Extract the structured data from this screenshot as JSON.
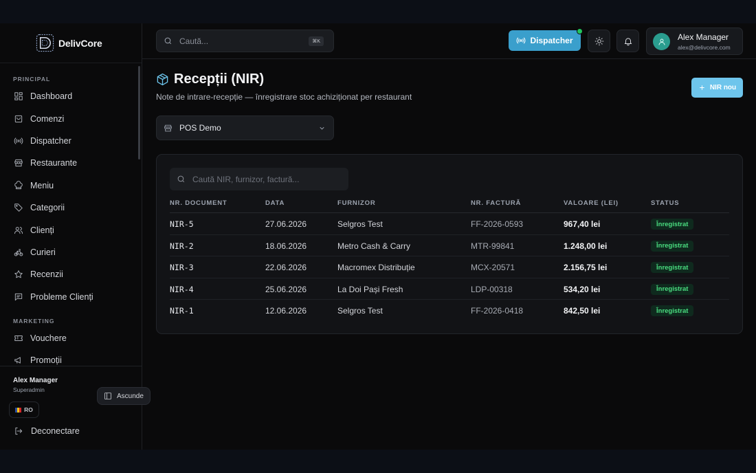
{
  "brand": {
    "name": "DelivCore"
  },
  "sidebar": {
    "sections": [
      {
        "label": "PRINCIPAL",
        "items": [
          {
            "label": "Dashboard",
            "icon": "dashboard-icon"
          },
          {
            "label": "Comenzi",
            "icon": "bag-icon"
          },
          {
            "label": "Dispatcher",
            "icon": "radio-icon"
          },
          {
            "label": "Restaurante",
            "icon": "store-icon"
          },
          {
            "label": "Meniu",
            "icon": "chef-hat-icon"
          },
          {
            "label": "Categorii",
            "icon": "tag-icon"
          },
          {
            "label": "Clienți",
            "icon": "users-icon"
          },
          {
            "label": "Curieri",
            "icon": "bike-icon"
          },
          {
            "label": "Recenzii",
            "icon": "star-icon"
          },
          {
            "label": "Probleme Clienți",
            "icon": "message-icon"
          }
        ]
      },
      {
        "label": "MARKETING",
        "items": [
          {
            "label": "Vouchere",
            "icon": "ticket-icon"
          },
          {
            "label": "Promoții",
            "icon": "megaphone-icon"
          }
        ]
      }
    ],
    "footer": {
      "user_name": "Alex Manager",
      "user_role": "Superadmin",
      "hide_label": "Ascunde",
      "lang_label": "RO",
      "logout_label": "Deconectare"
    }
  },
  "topbar": {
    "search_placeholder": "Caută...",
    "shortcut": "⌘K",
    "dispatcher_label": "Dispatcher",
    "user": {
      "name": "Alex Manager",
      "email": "alex@delivcore.com"
    }
  },
  "page": {
    "title": "Recepții (NIR)",
    "subtitle": "Note de intrare-recepție — înregistrare stoc achiziționat per restaurant",
    "new_button": "NIR nou",
    "restaurant_select": "POS Demo"
  },
  "table": {
    "search_placeholder": "Caută NIR, furnizor, factură...",
    "columns": [
      "NR. DOCUMENT",
      "DATA",
      "FURNIZOR",
      "NR. FACTURĂ",
      "VALOARE (LEI)",
      "STATUS"
    ],
    "rows": [
      {
        "doc": "NIR-5",
        "date": "27.06.2026",
        "supplier": "Selgros Test",
        "invoice": "FF-2026-0593",
        "value": "967,40 lei",
        "status": "Înregistrat"
      },
      {
        "doc": "NIR-2",
        "date": "18.06.2026",
        "supplier": "Metro Cash & Carry",
        "invoice": "MTR-99841",
        "value": "1.248,00 lei",
        "status": "Înregistrat"
      },
      {
        "doc": "NIR-3",
        "date": "22.06.2026",
        "supplier": "Macromex Distribuție",
        "invoice": "MCX-20571",
        "value": "2.156,75 lei",
        "status": "Înregistrat"
      },
      {
        "doc": "NIR-4",
        "date": "25.06.2026",
        "supplier": "La Doi Pași Fresh",
        "invoice": "LDP-00318",
        "value": "534,20 lei",
        "status": "Înregistrat"
      },
      {
        "doc": "NIR-1",
        "date": "12.06.2026",
        "supplier": "Selgros Test",
        "invoice": "FF-2026-0418",
        "value": "842,50 lei",
        "status": "Înregistrat"
      }
    ]
  },
  "colors": {
    "accent": "#3a9fcc",
    "accent_light": "#6ec5ec",
    "success": "#4ade80",
    "live": "#22c55e"
  }
}
